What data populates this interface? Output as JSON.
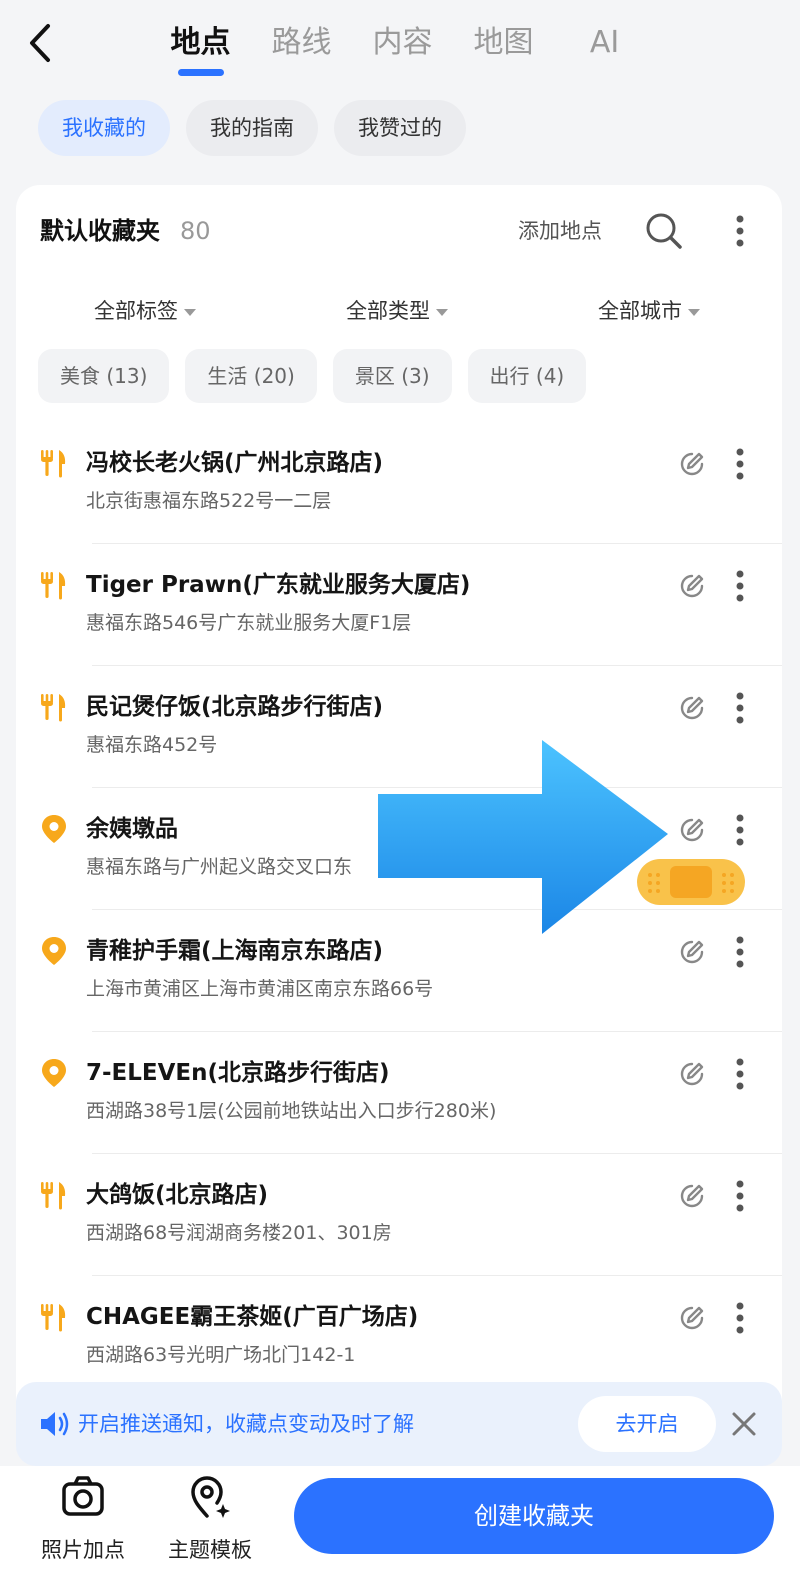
{
  "topbar": {
    "tabs": [
      {
        "label": "地点",
        "active": true
      },
      {
        "label": "路线",
        "active": false
      },
      {
        "label": "内容",
        "active": false
      },
      {
        "label": "地图",
        "active": false
      },
      {
        "label": "AI",
        "active": false
      }
    ]
  },
  "pills": [
    {
      "label": "我收藏的",
      "active": true
    },
    {
      "label": "我的指南",
      "active": false
    },
    {
      "label": "我赞过的",
      "active": false
    }
  ],
  "folder": {
    "title": "默认收藏夹",
    "count": "80",
    "add_place": "添加地点"
  },
  "dropdowns": [
    "全部标签",
    "全部类型",
    "全部城市"
  ],
  "categories": [
    "美食 (13)",
    "生活 (20)",
    "景区 (3)",
    "出行 (4)"
  ],
  "places": [
    {
      "icon": "food",
      "title": "冯校长老火锅(广州北京路店)",
      "address": "北京街惠福东路522号一二层"
    },
    {
      "icon": "food",
      "title": "Tiger Prawn(广东就业服务大厦店)",
      "address": "惠福东路546号广东就业服务大厦F1层"
    },
    {
      "icon": "food",
      "title": "民记煲仔饭(北京路步行街店)",
      "address": "惠福东路452号"
    },
    {
      "icon": "pin",
      "title": "余姨墩品",
      "address": "惠福东路与广州起义路交叉口东"
    },
    {
      "icon": "pin",
      "title": "青稚护手霜(上海南京东路店)",
      "address": "上海市黄浦区上海市黄浦区南京东路66号"
    },
    {
      "icon": "pin",
      "title": "7-ELEVEn(北京路步行街店)",
      "address": "西湖路38号1层(公园前地铁站出入口步行280米)"
    },
    {
      "icon": "food",
      "title": "大鸽饭(北京路店)",
      "address": "西湖路68号润湖商务楼201、301房"
    },
    {
      "icon": "food",
      "title": "CHAGEE霸王茶姬(广百广场店)",
      "address": "西湖路63号光明广场北门142-1"
    }
  ],
  "notify": {
    "text": "开启推送通知，收藏点变动及时了解",
    "button": "去开启"
  },
  "bottom": {
    "photo_label": "照片加点",
    "template_label": "主题模板",
    "create_label": "创建收藏夹"
  },
  "colors": {
    "accent": "#2b72ff",
    "icon_orange": "#f7a81b",
    "overlay_arrow": "#2ea6f2"
  }
}
